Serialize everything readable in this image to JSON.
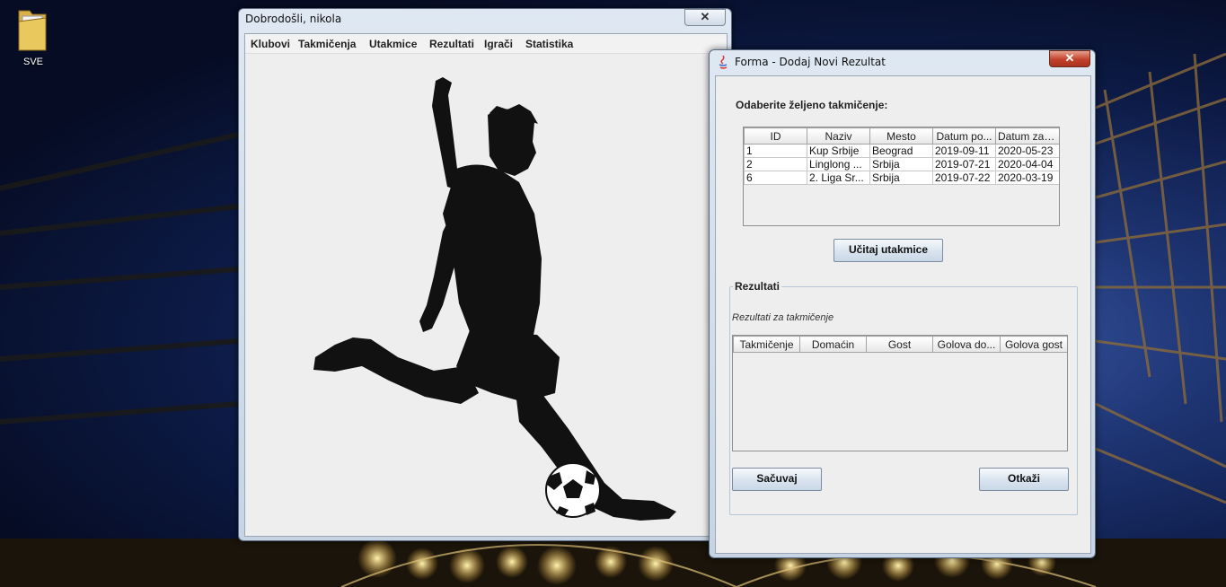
{
  "desktop": {
    "icon_label": "SVE"
  },
  "main_window": {
    "title": "Dobrodošli, nikola",
    "menu": [
      "Klubovi",
      "Takmičenja",
      "Utakmice",
      "Rezultati",
      "Igrači",
      "Statistika"
    ],
    "close_glyph": "✕"
  },
  "dialog": {
    "title": "Forma - Dodaj Novi Rezultat",
    "close_glyph": "✕",
    "prompt": "Odaberite željeno takmičenje:",
    "competitions_table": {
      "columns": [
        "ID",
        "Naziv",
        "Mesto",
        "Datum po...",
        "Datum zav..."
      ],
      "rows": [
        [
          "1",
          "Kup Srbije",
          "Beograd",
          "2019-09-11",
          "2020-05-23"
        ],
        [
          "2",
          "Linglong ...",
          "Srbija",
          "2019-07-21",
          "2020-04-04"
        ],
        [
          "6",
          "2. Liga Sr...",
          "Srbija",
          "2019-07-22",
          "2020-03-19"
        ]
      ]
    },
    "load_button": "Učitaj utakmice",
    "results_group_title": "Rezultati",
    "results_caption": "Rezultati za takmičenje",
    "results_table": {
      "columns": [
        "Takmičenje",
        "Domaćin",
        "Gost",
        "Golova do...",
        "Golova gost"
      ],
      "rows": []
    },
    "save_button": "Sačuvaj",
    "cancel_button": "Otkaži"
  },
  "colors": {
    "sky_dark": "#060c24",
    "sky_mid": "#1e3472",
    "stadium_light": "#f4d27a",
    "window_bg": "#eeeeee"
  },
  "icons": [
    "folder-icon",
    "java-icon",
    "close-icon"
  ]
}
